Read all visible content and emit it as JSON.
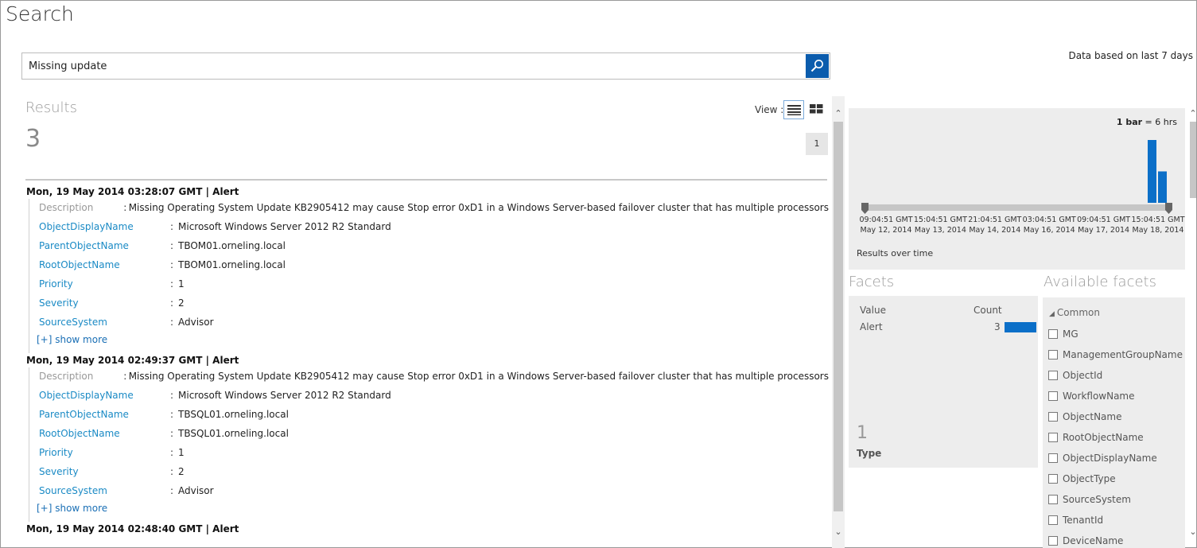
{
  "page": {
    "title": "Search"
  },
  "search": {
    "value": "Missing update",
    "placeholder": ""
  },
  "data_range": "Data based on last 7 days",
  "results": {
    "label": "Results",
    "count": "3",
    "view_label": "View :",
    "page_number": "1",
    "show_more_label": "[+] show more",
    "items": [
      {
        "header": "Mon, 19 May 2014 03:28:07 GMT | Alert",
        "fields": [
          {
            "name": "Description",
            "value": "Missing Operating System Update KB2905412 may cause Stop error 0xD1 in a Windows Server-based failover cluster that has multiple processors"
          },
          {
            "name": "ObjectDisplayName",
            "value": "Microsoft Windows Server 2012 R2 Standard"
          },
          {
            "name": "ParentObjectName",
            "value": "TBOM01.orneling.local"
          },
          {
            "name": "RootObjectName",
            "value": "TBOM01.orneling.local"
          },
          {
            "name": "Priority",
            "value": "1"
          },
          {
            "name": "Severity",
            "value": "2"
          },
          {
            "name": "SourceSystem",
            "value": "Advisor"
          }
        ]
      },
      {
        "header": "Mon, 19 May 2014 02:49:37 GMT | Alert",
        "fields": [
          {
            "name": "Description",
            "value": "Missing Operating System Update KB2905412 may cause Stop error 0xD1 in a Windows Server-based failover cluster that has multiple processors"
          },
          {
            "name": "ObjectDisplayName",
            "value": "Microsoft Windows Server 2012 R2 Standard"
          },
          {
            "name": "ParentObjectName",
            "value": "TBSQL01.orneling.local"
          },
          {
            "name": "RootObjectName",
            "value": "TBSQL01.orneling.local"
          },
          {
            "name": "Priority",
            "value": "1"
          },
          {
            "name": "Severity",
            "value": "2"
          },
          {
            "name": "SourceSystem",
            "value": "Advisor"
          }
        ]
      },
      {
        "header": "Mon, 19 May 2014 02:48:40 GMT | Alert",
        "fields": []
      }
    ]
  },
  "timeline": {
    "legend_bold": "1 bar",
    "legend_rest": " = 6 hrs",
    "caption": "Results over time",
    "ticks": [
      {
        "time": "09:04:51 GMT",
        "date": "May 12, 2014"
      },
      {
        "time": "15:04:51 GMT",
        "date": "May 13, 2014"
      },
      {
        "time": "21:04:51 GMT",
        "date": "May 14, 2014"
      },
      {
        "time": "03:04:51 GMT",
        "date": "May 16, 2014"
      },
      {
        "time": "09:04:51 GMT",
        "date": "May 17, 2014"
      },
      {
        "time": "15:04:51 GMT",
        "date": "May 18, 2014"
      }
    ],
    "bars": [
      2,
      1
    ],
    "bar_color": "#0b6fc8"
  },
  "facets": {
    "label": "Facets",
    "value_header": "Value",
    "count_header": "Count",
    "rows": [
      {
        "value": "Alert",
        "count": "3"
      }
    ],
    "type_count": "1",
    "type_label": "Type"
  },
  "available_facets": {
    "label": "Available facets",
    "group": "Common",
    "items": [
      "MG",
      "ManagementGroupName",
      "ObjectId",
      "WorkflowName",
      "ObjectName",
      "RootObjectName",
      "ObjectDisplayName",
      "ObjectType",
      "SourceSystem",
      "TenantId",
      "DeviceName"
    ]
  },
  "colors": {
    "accent": "#0b5cad",
    "link": "#1a8ac5",
    "bar": "#0b6fc8"
  }
}
